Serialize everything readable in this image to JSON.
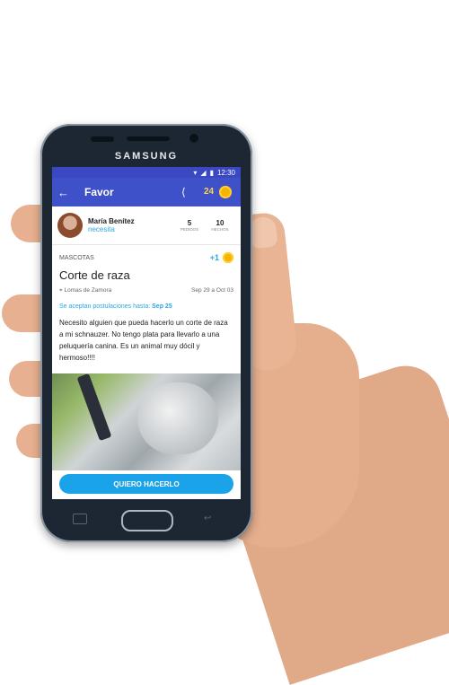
{
  "device": {
    "brand": "SAMSUNG"
  },
  "status_bar": {
    "time": "12:30"
  },
  "app_bar": {
    "back_icon": "arrow-left-icon",
    "title": "Favor",
    "share_icon": "share-icon",
    "coins": "24"
  },
  "user": {
    "name": "María Benítez",
    "role": "necesita",
    "stats": [
      {
        "value": "5",
        "label": "PEDIDOS"
      },
      {
        "value": "10",
        "label": "HECHOS"
      }
    ]
  },
  "post": {
    "category": "MASCOTAS",
    "reward": "+1",
    "title": "Corte de raza",
    "location": "Lomas de Zamora",
    "dates": "Sep 29 a Oct 03",
    "deadline_label": "Se aceptan postulaciones hasta:",
    "deadline_value": "Sep 25",
    "description": "Necesito alguien que pueda hacerlo un corte de raza a mi schnauzer. No tengo plata para llevarlo a una peluquería canina. Es un animal muy dócil y hermoso!!!!"
  },
  "cta": {
    "label": "QUIERO HACERLO"
  },
  "colors": {
    "primary": "#3f51c8",
    "accent": "#1aa3e8",
    "coin": "#f4b400"
  }
}
